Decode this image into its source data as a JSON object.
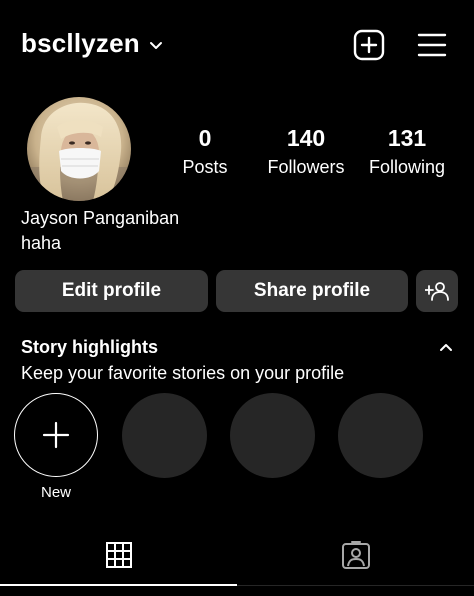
{
  "header": {
    "username": "bscllyzen",
    "new_icon": "plus-square-icon",
    "menu_icon": "hamburger-menu-icon"
  },
  "profile": {
    "avatar_icon": "profile-photo",
    "stats": {
      "posts": {
        "value": "0",
        "label": "Posts"
      },
      "followers": {
        "value": "140",
        "label": "Followers"
      },
      "following": {
        "value": "131",
        "label": "Following"
      }
    },
    "display_name": "Jayson Panganiban",
    "bio": "haha"
  },
  "actions": {
    "edit_label": "Edit profile",
    "share_label": "Share profile",
    "add_friend_icon": "add-person-icon"
  },
  "highlights": {
    "title": "Story highlights",
    "subtitle": "Keep your favorite stories on your profile",
    "new_label": "New",
    "placeholder_count": 3
  },
  "tabs": {
    "grid_icon": "grid-icon",
    "tagged_icon": "tagged-person-icon",
    "active": "grid"
  },
  "colors": {
    "background": "#000000",
    "button_bg": "#363636",
    "placeholder_circle": "#262626",
    "text": "#ffffff"
  }
}
